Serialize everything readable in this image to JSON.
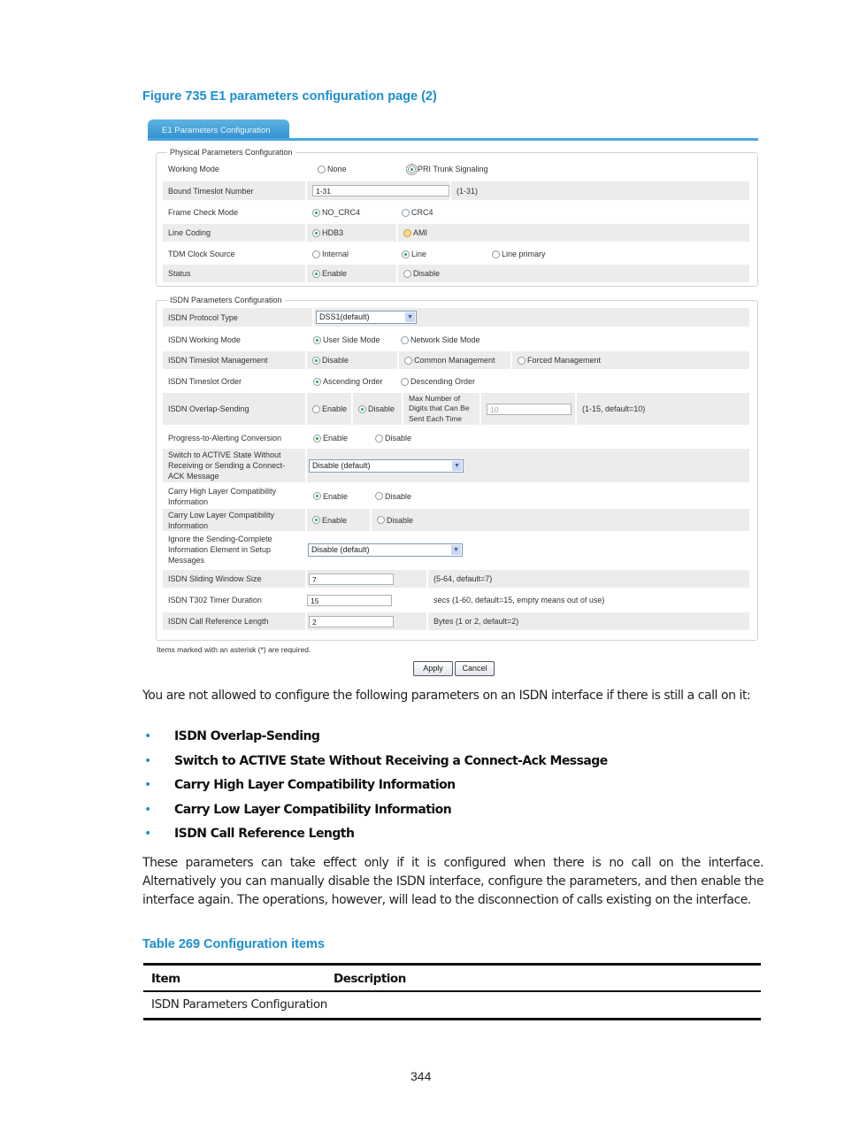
{
  "figure_caption": "Figure 735 E1 parameters configuration page (2)",
  "tab_label": "E1 Parameters Configuration",
  "physical": {
    "legend": "Physical Parameters Configuration",
    "working_mode": {
      "label": "Working Mode",
      "options": [
        "None",
        "PRI Trunk Signaling"
      ],
      "selected": "PRI Trunk Signaling"
    },
    "bound_timeslot": {
      "label": "Bound Timeslot Number",
      "value": "1-31",
      "hint": "(1-31)"
    },
    "frame_check": {
      "label": "Frame Check Mode",
      "options": [
        "NO_CRC4",
        "CRC4"
      ],
      "selected": "NO_CRC4"
    },
    "line_coding": {
      "label": "Line Coding",
      "options": [
        "HDB3",
        "AMI"
      ],
      "selected": "HDB3"
    },
    "tdm_clock": {
      "label": "TDM Clock Source",
      "options": [
        "Internal",
        "Line",
        "Line primary"
      ],
      "selected": "Line"
    },
    "status": {
      "label": "Status",
      "options": [
        "Enable",
        "Disable"
      ],
      "selected": "Enable"
    }
  },
  "isdn": {
    "legend": "ISDN Parameters Configuration",
    "protocol_type": {
      "label": "ISDN Protocol Type",
      "value": "DSS1(default)"
    },
    "working_mode": {
      "label": "ISDN Working Mode",
      "options": [
        "User Side Mode",
        "Network Side Mode"
      ],
      "selected": "User Side Mode"
    },
    "timeslot_mgmt": {
      "label": "ISDN Timeslot Management",
      "options": [
        "Disable",
        "Common Management",
        "Forced Management"
      ],
      "selected": "Disable"
    },
    "timeslot_order": {
      "label": "ISDN Timeslot Order",
      "options": [
        "Ascending Order",
        "Descending Order"
      ],
      "selected": "Ascending Order"
    },
    "overlap": {
      "label": "ISDN Overlap-Sending",
      "options": [
        "Enable",
        "Disable"
      ],
      "selected": "Disable",
      "max_digits_label": "Max Number of Digits that Can Be Sent Each Time",
      "max_digits_value": "10",
      "hint": "(1-15, default=10)"
    },
    "progress_alerting": {
      "label": "Progress-to-Alerting Conversion",
      "options": [
        "Enable",
        "Disable"
      ],
      "selected": "Enable"
    },
    "switch_active": {
      "label": "Switch to ACTIVE State Without Receiving or Sending a Connect-ACK Message",
      "value": "Disable (default)"
    },
    "carry_high": {
      "label": "Carry High Layer Compatibility Information",
      "options": [
        "Enable",
        "Disable"
      ],
      "selected": "Enable"
    },
    "carry_low": {
      "label": "Carry Low Layer Compatibility Information",
      "options": [
        "Enable",
        "Disable"
      ],
      "selected": "Enable"
    },
    "ignore_sending": {
      "label": "Ignore the Sending-Complete Information Element in Setup Messages",
      "value": "Disable (default)"
    },
    "sliding_window": {
      "label": "ISDN Sliding Window Size",
      "value": "7",
      "hint": "(5-64, default=7)"
    },
    "t302": {
      "label": "ISDN T302 Timer Duration",
      "value": "15",
      "hint": "secs (1-60, default=15, empty means out of use)"
    },
    "call_ref": {
      "label": "ISDN Call Reference Length",
      "value": "2",
      "hint": "Bytes (1 or 2, default=2)"
    }
  },
  "required_note": "Items marked with an asterisk (*) are required.",
  "buttons": {
    "apply": "Apply",
    "cancel": "Cancel"
  },
  "body": {
    "intro": "You are not allowed to configure the following parameters on an ISDN interface if there is still a call on it:",
    "bullets": [
      "ISDN Overlap-Sending",
      "Switch to ACTIVE State Without Receiving a Connect-Ack Message",
      "Carry High Layer Compatibility Information",
      "Carry Low Layer Compatibility Information",
      "ISDN Call Reference Length"
    ],
    "bullet_glyph": "•",
    "para2": "These parameters can take effect only if it is configured when there is no call on the interface. Alternatively you can manually disable the ISDN interface, configure the parameters, and then enable the interface again. The operations, however, will lead to the disconnection of calls existing on the interface."
  },
  "table": {
    "caption": "Table 269 Configuration items",
    "headers": [
      "Item",
      "Description"
    ],
    "rows": [
      [
        "ISDN Parameters Configuration",
        ""
      ]
    ]
  },
  "page_number": "344",
  "colors": {
    "accent": "#1d8fcf",
    "tab": "#2e8fcf",
    "radio_on": "#2aa84a"
  }
}
